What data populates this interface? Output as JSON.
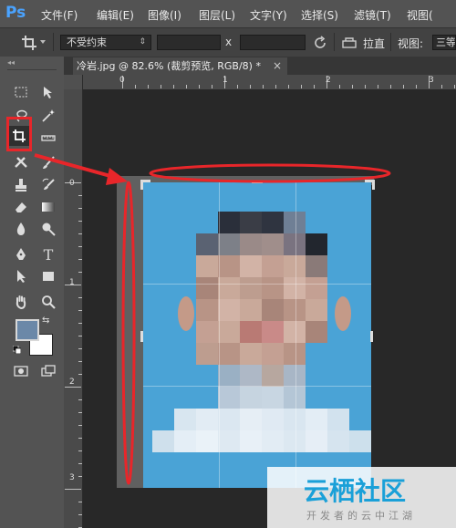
{
  "app": {
    "logo": "Ps"
  },
  "menu": [
    {
      "label": "文件(F)"
    },
    {
      "label": "编辑(E)"
    },
    {
      "label": "图像(I)"
    },
    {
      "label": "图层(L)"
    },
    {
      "label": "文字(Y)"
    },
    {
      "label": "选择(S)"
    },
    {
      "label": "滤镜(T)"
    },
    {
      "label": "视图("
    }
  ],
  "options": {
    "preset_value": "不受约束",
    "ratio_separator": "x",
    "straighten_label": "拉直",
    "view_label": "视图:",
    "view_value": "三等"
  },
  "document_tab": {
    "title": "冷岩.jpg @ 82.6% (裁剪预览, RGB/8) *",
    "close": "×"
  },
  "rulers": {
    "top_labels": [
      "0",
      "1",
      "2",
      "3"
    ],
    "left_labels": [
      "0",
      "1",
      "2",
      "3"
    ]
  },
  "watermark": {
    "title": "云栖社区",
    "subtitle": "开发者的云中江湖"
  },
  "colors": {
    "annotation_red": "#e8262a",
    "photo_background": "#4aa3d6",
    "watermark_blue": "#1aa0d8"
  }
}
